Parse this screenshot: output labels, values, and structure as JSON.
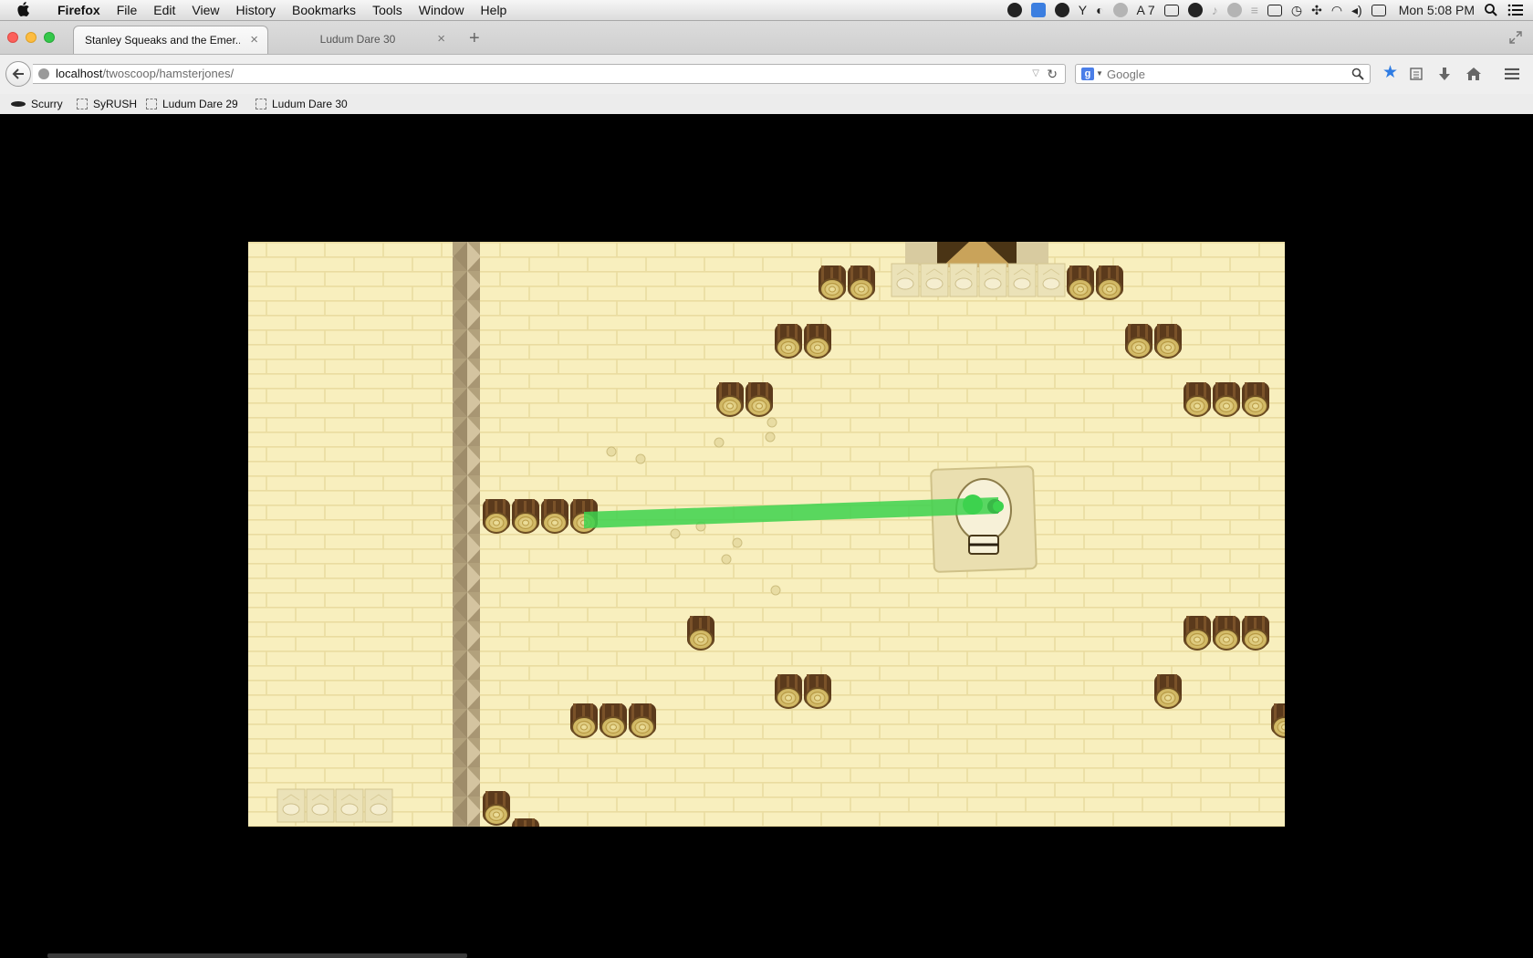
{
  "menubar": {
    "app_name": "Firefox",
    "items": [
      "File",
      "Edit",
      "View",
      "History",
      "Bookmarks",
      "Tools",
      "Window",
      "Help"
    ],
    "status": {
      "notification_count": "7",
      "clock": "Mon 5:08 PM"
    }
  },
  "browser": {
    "tabs": [
      {
        "title": "Stanley Squeaks and the Emer...",
        "close_label": "×",
        "active": true
      },
      {
        "title": "Ludum Dare 30",
        "close_label": "×",
        "active": false
      }
    ],
    "new_tab_label": "+",
    "url": {
      "host": "localhost",
      "path": "/twoscoop/hamsterjones/"
    },
    "search": {
      "placeholder": "Google",
      "value": ""
    },
    "bookmarks": [
      {
        "label": "Scurry",
        "icon": "scurry-icon"
      },
      {
        "label": "SyRUSH",
        "icon": "page-icon"
      },
      {
        "label": "Ludum Dare 29",
        "icon": "page-icon"
      },
      {
        "label": "Ludum Dare 30",
        "icon": "page-icon"
      }
    ]
  },
  "game": {
    "colors": {
      "wall_bg": "#f8efbe",
      "brick_line": "#ebdc9f",
      "pillar": "#b7a888",
      "log_bark": "#5b3a1c",
      "log_face": "#d8c06a",
      "laser": "#3dd24e",
      "skull_block": "#eadfb0"
    }
  }
}
